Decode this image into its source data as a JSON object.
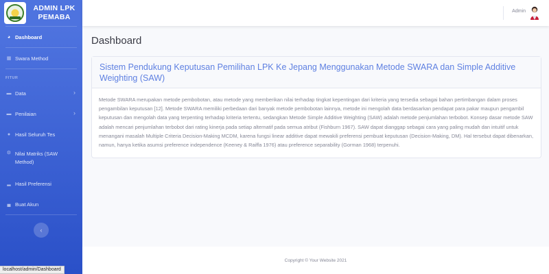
{
  "sidebar": {
    "brand_line1": "ADMIN LPK",
    "brand_line2": "PEMABA",
    "items": [
      {
        "label": "Dashboard",
        "icon": "tachometer-icon"
      },
      {
        "label": "Swara Method",
        "icon": "table-icon"
      },
      {
        "label": "Data",
        "icon": "folder-icon"
      },
      {
        "label": "Penilaian",
        "icon": "folder-icon"
      },
      {
        "label": "Hasil Seluruh Tes",
        "icon": "check-circle-icon"
      },
      {
        "label": "Nilai Matriks (SAW Method)",
        "icon": "cogs-icon"
      },
      {
        "label": "Hasil Preferensi",
        "icon": "chart-bar-icon"
      },
      {
        "label": "Buat Akun",
        "icon": "chart-area-icon"
      }
    ],
    "section_heading": "FITUR",
    "toggle_icon": "chevron-left-icon"
  },
  "topbar": {
    "user_name": "Admin"
  },
  "main": {
    "page_title": "Dashboard",
    "card_title": "Sistem Pendukung Keputusan Pemilihan LPK Ke Jepang Menggunakan Metode SWARA dan Simple Additive Weighting (SAW)",
    "card_body": "Metode SWARA merupakan metode pembobotan, atau metode yang memberikan nilai terhadap tingkat kepentingan dari kriteria yang tersedia sebagai bahan pertimbangan dalam proses pengambilan keputusan [12]. Metode SWARA memiliki perbedaan dari banyak metode pembobotan lainnya, metode ini mengolah data berdasarkan pendapat para pakar maupun pengambil keputusan dan mengolah data yang terpenting terhadap kriteria tertentu, sedangkan Metode Simple Additive Weighting (SAW) adalah metode penjumlahan terbobot. Konsep dasar metode SAW adalah mencari penjumlahan terbobot dari rating kinerja pada setiap alternatif pada semua atribut (Fishburn 1967). SAW dapat dianggap sebagai cara yang paling mudah dan intuitif untuk menangani masalah Multiple Criteria Decision-Making MCDM, karena fungsi linear additive dapat mewakili preferensi pembuat keputusan (Decision-Making, DM). Hal tersebut dapat dibenarkan, namun, hanya ketika asumsi preference independence (Keeney & Raiffa 1976) atau preference separability (Gorman 1968) terpenuhi."
  },
  "footer": {
    "copyright": "Copyright © Your Website 2021"
  },
  "statusbar": {
    "url": "localhost/admin/Dashboard"
  },
  "colors": {
    "sidebar_primary": "#4e73df",
    "page_bg": "#f8f9fc",
    "text_muted": "#858796"
  }
}
